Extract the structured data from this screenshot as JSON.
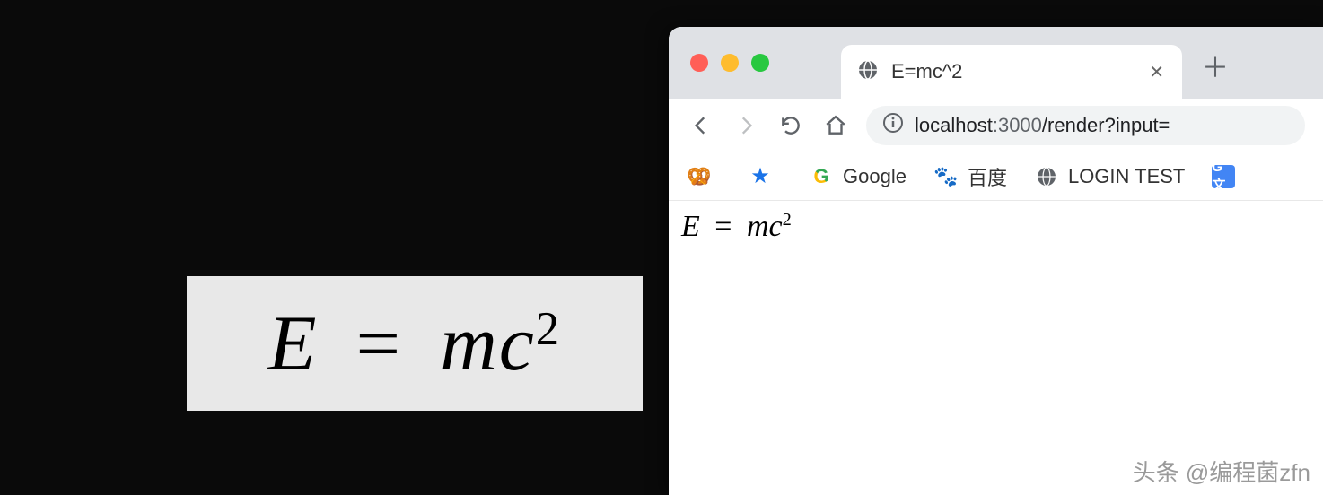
{
  "left_formula": {
    "E": "E",
    "equals": "=",
    "mc": "mc",
    "exponent": "2"
  },
  "browser": {
    "tab": {
      "title": "E=mc^2"
    },
    "url": {
      "host": "localhost",
      "port": ":3000",
      "path": "/render?input="
    },
    "bookmarks": [
      {
        "icon": "pretzel",
        "label": ""
      },
      {
        "icon": "star",
        "label": ""
      },
      {
        "icon": "google-g",
        "label": "Google"
      },
      {
        "icon": "baidu-paw",
        "label": "百度"
      },
      {
        "icon": "globe-dark",
        "label": "LOGIN TEST"
      },
      {
        "icon": "gtranslate",
        "label": ""
      }
    ],
    "content_formula": {
      "E": "E",
      "equals": "=",
      "mc": "mc",
      "exponent": "2"
    }
  },
  "watermark": "头条 @编程菌zfn"
}
